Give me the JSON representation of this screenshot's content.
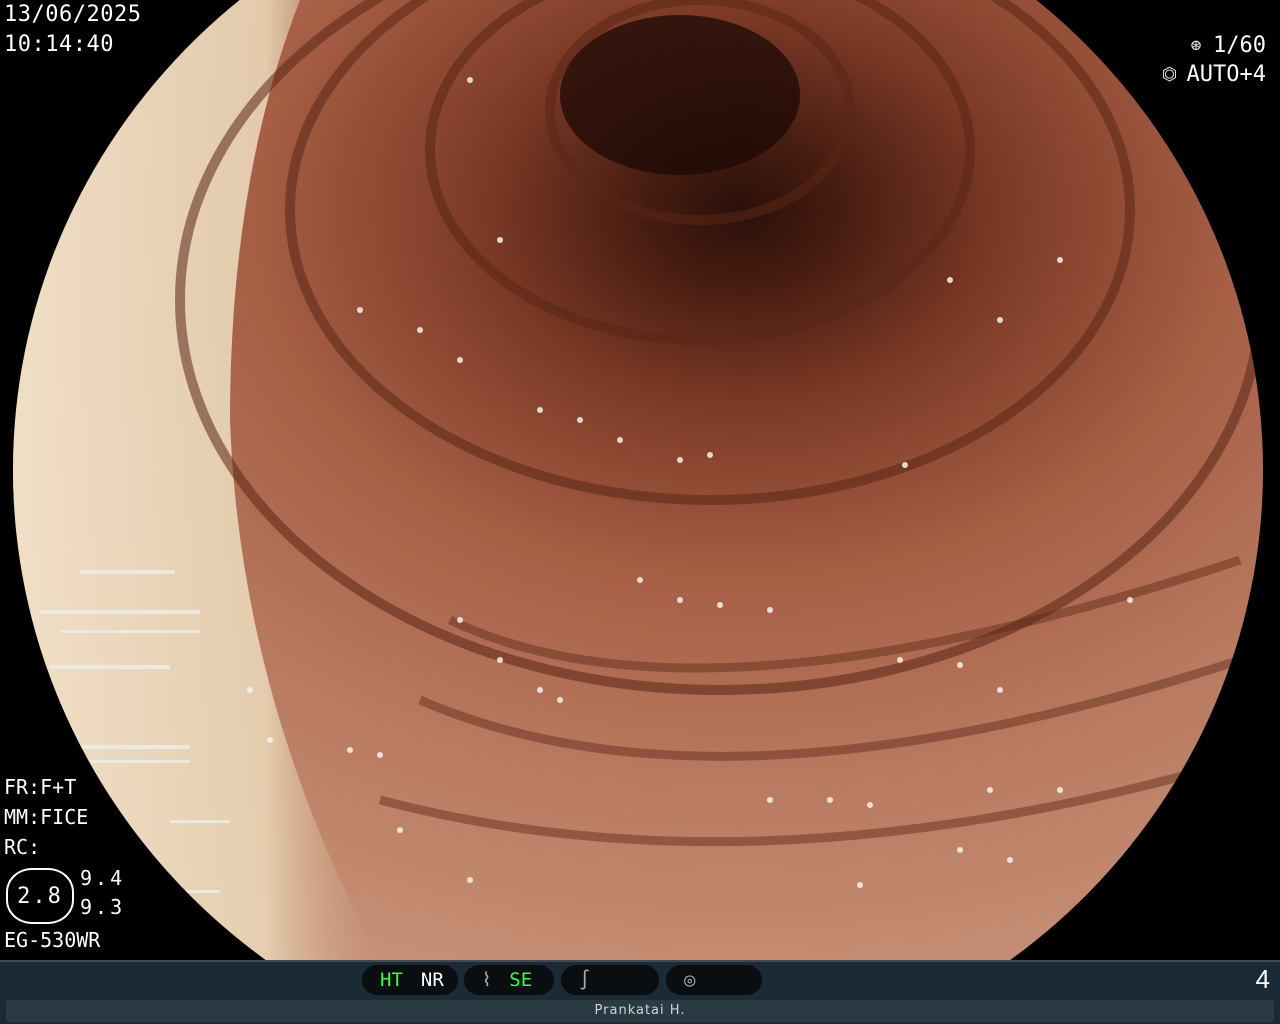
{
  "overlay": {
    "date": "13/06/2025",
    "time": "10:14:40",
    "shutter": "1/60",
    "iris": "AUTO+4",
    "shutter_icon": "shutter-icon",
    "iris_icon": "iris-icon"
  },
  "settings": {
    "fr": "FR:F+T",
    "mm": "MM:FICE",
    "rc": "RC:",
    "enhancement_main": "2.8",
    "enhancement_a": "9.4",
    "enhancement_b": "9.3",
    "scope_model": "EG-530WR"
  },
  "status_bar": {
    "ht": "HT",
    "nr": "NR",
    "se": "SE",
    "page": "4",
    "patient": "Prankatai H."
  },
  "colors": {
    "active": "#3aff3a",
    "bar": "#1b2a34"
  }
}
